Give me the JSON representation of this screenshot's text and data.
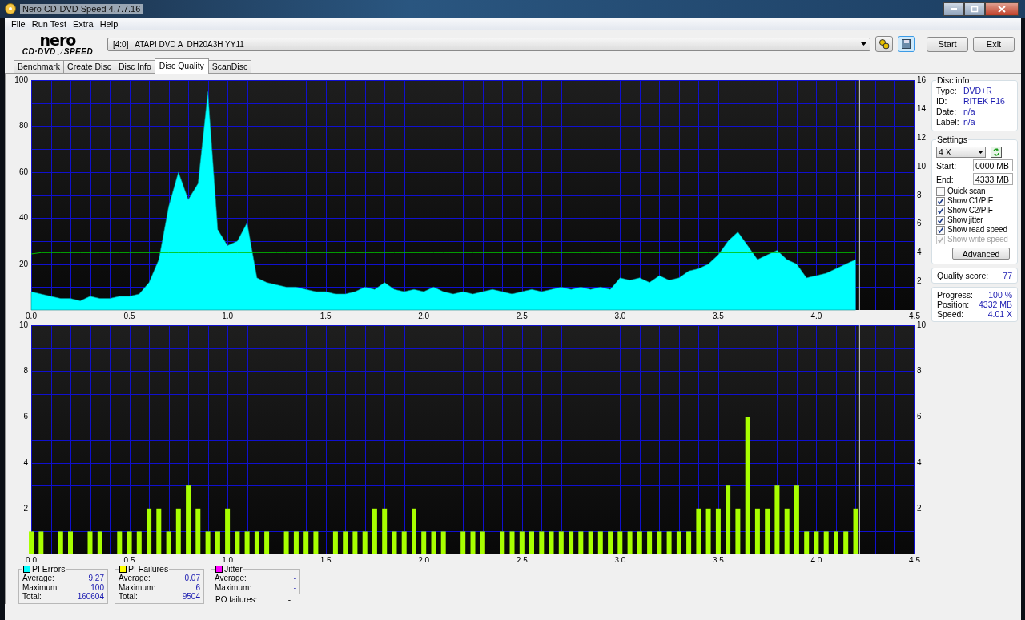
{
  "window": {
    "title": "Nero CD-DVD Speed 4.7.7.16"
  },
  "menu": [
    "File",
    "Run Test",
    "Extra",
    "Help"
  ],
  "logo": {
    "top": "nero",
    "left": "CD·DVD",
    "right": "SPEED"
  },
  "drive": "[4:0]   ATAPI DVD A  DH20A3H YY11",
  "buttons": [
    "Start",
    "Exit"
  ],
  "tabs": [
    {
      "label": "Benchmark",
      "selected": false
    },
    {
      "label": "Create Disc",
      "selected": false
    },
    {
      "label": "Disc Info",
      "selected": false
    },
    {
      "label": "Disc Quality",
      "selected": true
    },
    {
      "label": "ScanDisc",
      "selected": false
    }
  ],
  "charts": [
    {
      "chart_data": {
        "type": "area",
        "grid": true,
        "ref_lines": [
          {
            "axis": "x",
            "value": 4.22,
            "color": "#d0d0d0"
          }
        ],
        "xlim": [
          0,
          4.5
        ],
        "ylim": [
          0,
          100
        ],
        "y2lim": [
          0,
          16
        ],
        "xticks": [
          {
            "value": 0,
            "label": "0.0"
          },
          {
            "value": 0.5,
            "label": "0.5"
          },
          {
            "value": 1,
            "label": "1.0"
          },
          {
            "value": 1.5,
            "label": "1.5"
          },
          {
            "value": 2,
            "label": "2.0"
          },
          {
            "value": 2.5,
            "label": "2.5"
          },
          {
            "value": 3,
            "label": "3.0"
          },
          {
            "value": 3.5,
            "label": "3.5"
          },
          {
            "value": 4,
            "label": "4.0"
          },
          {
            "value": 4.5,
            "label": "4.5"
          }
        ],
        "yticks": [
          20,
          40,
          60,
          80,
          100
        ],
        "y2ticks": [
          2,
          4,
          6,
          8,
          10,
          12,
          14,
          16
        ],
        "x": [
          0,
          0.05,
          0.1,
          0.15,
          0.2,
          0.25,
          0.3,
          0.35,
          0.4,
          0.45,
          0.5,
          0.55,
          0.6,
          0.65,
          0.7,
          0.75,
          0.8,
          0.85,
          0.9,
          0.95,
          1,
          1.05,
          1.1,
          1.15,
          1.2,
          1.25,
          1.3,
          1.35,
          1.4,
          1.45,
          1.5,
          1.55,
          1.6,
          1.65,
          1.7,
          1.75,
          1.8,
          1.85,
          1.9,
          1.95,
          2,
          2.05,
          2.1,
          2.15,
          2.2,
          2.25,
          2.3,
          2.35,
          2.4,
          2.45,
          2.5,
          2.55,
          2.6,
          2.65,
          2.7,
          2.75,
          2.8,
          2.85,
          2.9,
          2.95,
          3,
          3.05,
          3.1,
          3.15,
          3.2,
          3.25,
          3.3,
          3.35,
          3.4,
          3.45,
          3.5,
          3.55,
          3.6,
          3.65,
          3.7,
          3.75,
          3.8,
          3.85,
          3.9,
          3.95,
          4,
          4.05,
          4.1,
          4.15,
          4.2
        ],
        "series": [
          {
            "color": "#00ffff",
            "values": [
              8,
              7,
              6,
              5,
              5,
              4,
              6,
              5,
              5,
              6,
              6,
              7,
              12,
              22,
              45,
              60,
              48,
              55,
              95,
              35,
              28,
              30,
              38,
              14,
              12,
              11,
              10,
              10,
              9,
              8,
              8,
              7,
              7,
              8,
              10,
              9,
              12,
              9,
              8,
              9,
              8,
              10,
              8,
              7,
              8,
              7,
              8,
              9,
              8,
              7,
              8,
              9,
              8,
              9,
              10,
              9,
              10,
              9,
              10,
              9,
              14,
              13,
              14,
              12,
              15,
              13,
              14,
              17,
              18,
              20,
              24,
              30,
              34,
              28,
              22,
              24,
              26,
              22,
              20,
              14,
              15,
              16,
              18,
              20,
              22
            ]
          },
          {
            "type": "line",
            "color": "#00c000",
            "axis": "y2",
            "values": [
              3.9,
              4,
              4,
              4,
              4,
              4,
              4,
              4,
              4,
              4,
              4,
              4,
              4,
              4,
              4,
              4,
              4,
              4,
              4,
              4,
              4,
              4,
              4,
              4,
              4,
              4,
              4,
              4,
              4,
              4,
              4,
              4,
              4,
              4,
              4,
              4,
              4,
              4,
              4,
              4,
              4,
              4,
              4,
              4,
              4,
              4,
              4,
              4,
              4,
              4,
              4,
              4,
              4,
              4,
              4,
              4,
              4,
              4,
              4,
              4,
              4,
              4,
              4,
              4,
              4,
              4,
              4,
              4,
              4,
              4,
              4,
              4,
              4,
              4,
              4,
              4,
              4,
              4,
              4,
              4,
              4,
              4,
              4,
              4,
              4
            ]
          }
        ]
      }
    },
    {
      "chart_data": {
        "type": "bar",
        "grid": true,
        "ref_lines": [
          {
            "axis": "x",
            "value": 4.22,
            "color": "#d0d0d0"
          }
        ],
        "xlim": [
          0,
          4.5
        ],
        "ylim": [
          0,
          10
        ],
        "y2lim": [
          0,
          10
        ],
        "xticks": [
          {
            "value": 0,
            "label": "0.0"
          },
          {
            "value": 0.5,
            "label": "0.5"
          },
          {
            "value": 1,
            "label": "1.0"
          },
          {
            "value": 1.5,
            "label": "1.5"
          },
          {
            "value": 2,
            "label": "2.0"
          },
          {
            "value": 2.5,
            "label": "2.5"
          },
          {
            "value": 3,
            "label": "3.0"
          },
          {
            "value": 3.5,
            "label": "3.5"
          },
          {
            "value": 4,
            "label": "4.0"
          },
          {
            "value": 4.5,
            "label": "4.5"
          }
        ],
        "yticks": [
          2,
          4,
          6,
          8,
          10
        ],
        "y2ticks": [
          2,
          4,
          6,
          8,
          10
        ],
        "x": [
          0,
          0.05,
          0.1,
          0.15,
          0.2,
          0.25,
          0.3,
          0.35,
          0.4,
          0.45,
          0.5,
          0.55,
          0.6,
          0.65,
          0.7,
          0.75,
          0.8,
          0.85,
          0.9,
          0.95,
          1,
          1.05,
          1.1,
          1.15,
          1.2,
          1.25,
          1.3,
          1.35,
          1.4,
          1.45,
          1.5,
          1.55,
          1.6,
          1.65,
          1.7,
          1.75,
          1.8,
          1.85,
          1.9,
          1.95,
          2,
          2.05,
          2.1,
          2.15,
          2.2,
          2.25,
          2.3,
          2.35,
          2.4,
          2.45,
          2.5,
          2.55,
          2.6,
          2.65,
          2.7,
          2.75,
          2.8,
          2.85,
          2.9,
          2.95,
          3,
          3.05,
          3.1,
          3.15,
          3.2,
          3.25,
          3.3,
          3.35,
          3.4,
          3.45,
          3.5,
          3.55,
          3.6,
          3.65,
          3.7,
          3.75,
          3.8,
          3.85,
          3.9,
          3.95,
          4,
          4.05,
          4.1,
          4.15,
          4.2
        ],
        "series": [
          {
            "color": "#a8ff00",
            "values": [
              1,
              1,
              0,
              1,
              1,
              0,
              1,
              1,
              0,
              1,
              1,
              1,
              2,
              2,
              1,
              2,
              3,
              2,
              1,
              1,
              2,
              1,
              1,
              1,
              1,
              0,
              1,
              1,
              1,
              1,
              0,
              1,
              1,
              1,
              1,
              2,
              2,
              1,
              1,
              2,
              1,
              1,
              1,
              0,
              1,
              1,
              1,
              0,
              1,
              1,
              1,
              1,
              1,
              1,
              1,
              1,
              1,
              1,
              1,
              1,
              1,
              1,
              1,
              1,
              1,
              1,
              1,
              1,
              2,
              2,
              2,
              3,
              2,
              6,
              2,
              2,
              3,
              2,
              3,
              1,
              1,
              1,
              1,
              1,
              2
            ]
          }
        ]
      }
    }
  ],
  "disc_info": {
    "title": "Disc info",
    "fields": [
      {
        "label": "Type:",
        "value": "DVD+R"
      },
      {
        "label": "ID:",
        "value": "RITEK F16"
      },
      {
        "label": "Date:",
        "value": "n/a"
      },
      {
        "label": "Label:",
        "value": "n/a"
      }
    ]
  },
  "settings": {
    "title": "Settings",
    "speed": "4 X",
    "start_label": "Start:",
    "start": "0000 MB",
    "end_label": "End:",
    "end": "4333 MB",
    "options": [
      {
        "label": "Quick scan",
        "checked": false,
        "disabled": false
      },
      {
        "label": "Show C1/PIE",
        "checked": true,
        "disabled": false
      },
      {
        "label": "Show C2/PIF",
        "checked": true,
        "disabled": false
      },
      {
        "label": "Show jitter",
        "checked": true,
        "disabled": false
      },
      {
        "label": "Show read speed",
        "checked": true,
        "disabled": false
      },
      {
        "label": "Show write speed",
        "checked": true,
        "disabled": true
      }
    ],
    "advanced": "Advanced"
  },
  "quality": {
    "label": "Quality score:",
    "value": "77"
  },
  "progress": [
    {
      "label": "Progress:",
      "value": "100 %"
    },
    {
      "label": "Position:",
      "value": "4332 MB"
    },
    {
      "label": "Speed:",
      "value": "4.01 X"
    }
  ],
  "stats": [
    {
      "title": "PI Errors",
      "color": "#00ffff",
      "rows": [
        {
          "label": "Average:",
          "value": "9.27"
        },
        {
          "label": "Maximum:",
          "value": "100"
        },
        {
          "label": "Total:",
          "value": "160604"
        }
      ]
    },
    {
      "title": "PI Failures",
      "color": "#ffff00",
      "rows": [
        {
          "label": "Average:",
          "value": "0.07"
        },
        {
          "label": "Maximum:",
          "value": "6"
        },
        {
          "label": "Total:",
          "value": "9504"
        }
      ]
    },
    {
      "title": "Jitter",
      "color": "#ff00ff",
      "rows": [
        {
          "label": "Average:",
          "value": "-"
        },
        {
          "label": "Maximum:",
          "value": "-"
        }
      ]
    }
  ],
  "po_failures": {
    "label": "PO failures:",
    "value": "-"
  }
}
